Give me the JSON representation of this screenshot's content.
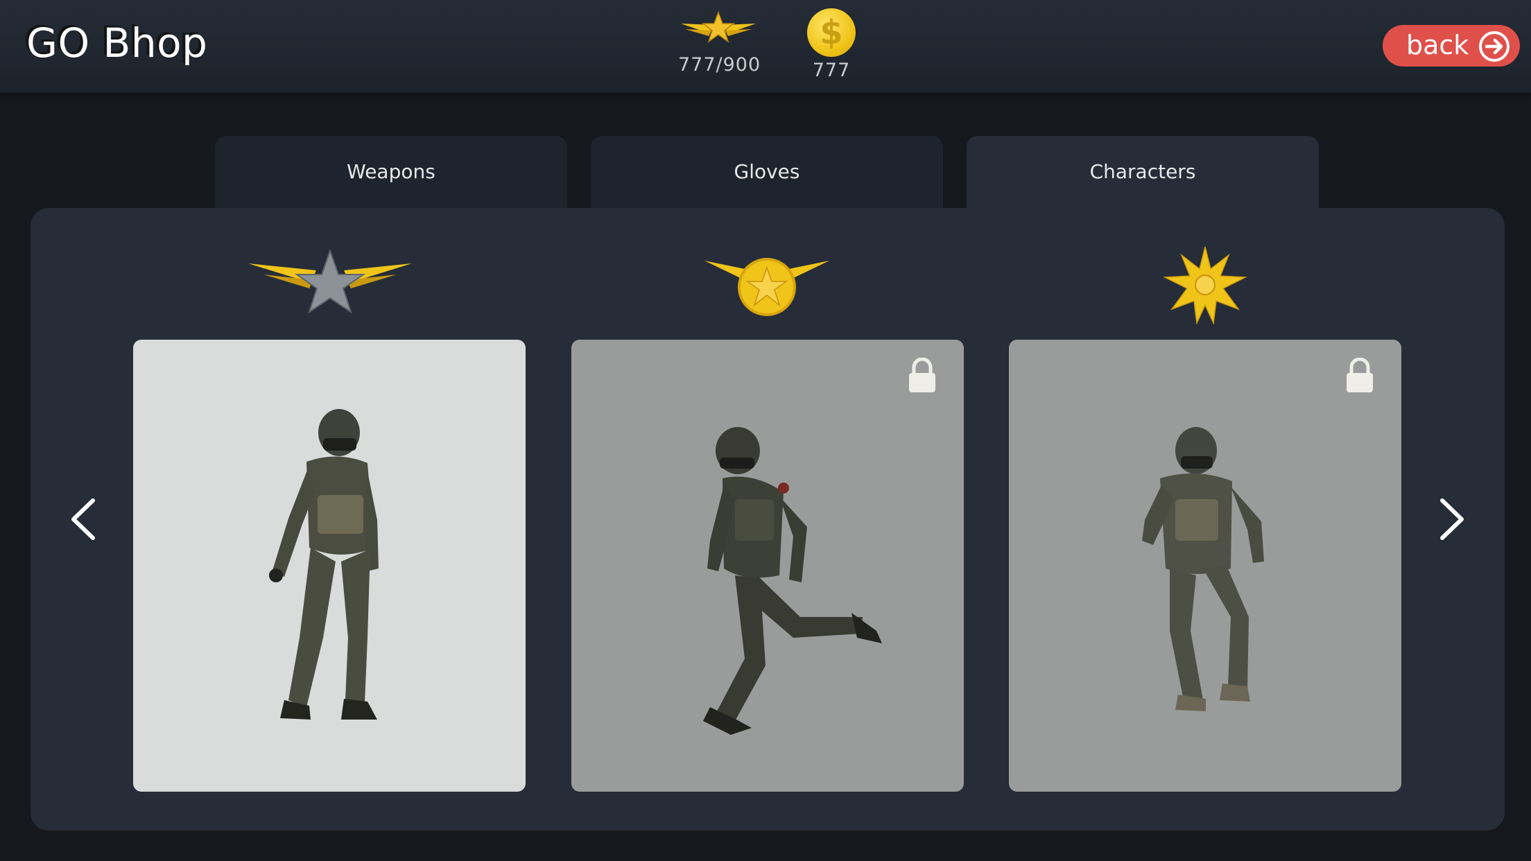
{
  "app": {
    "title": "GO Bhop"
  },
  "header": {
    "rank_progress": "777/900",
    "coins": "777",
    "coin_symbol": "$",
    "back_label": "back"
  },
  "tabs": [
    {
      "label": "Weapons",
      "active": false
    },
    {
      "label": "Gloves",
      "active": false
    },
    {
      "label": "Characters",
      "active": true
    }
  ],
  "characters": [
    {
      "rank_icon": "silver-star-wings-icon",
      "locked": false,
      "selected": true
    },
    {
      "rank_icon": "gold-star-medal-wings-icon",
      "locked": true,
      "selected": false
    },
    {
      "rank_icon": "gold-starburst-icon",
      "locked": true,
      "selected": false
    }
  ],
  "colors": {
    "background": "#15181c",
    "panel": "#262d38",
    "back_button": "#e0504a",
    "gold": "#f0c419",
    "card_selected": "#d9dcdb",
    "card_locked": "#9a9c9b"
  }
}
